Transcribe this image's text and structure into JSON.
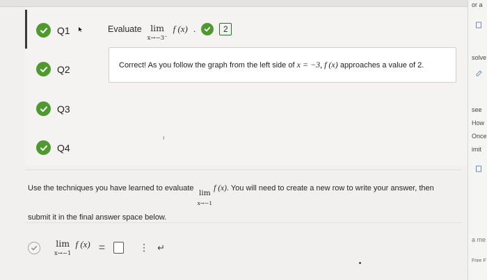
{
  "questions": [
    {
      "label": "Q1",
      "status": "correct",
      "active": true
    },
    {
      "label": "Q2",
      "status": "correct",
      "active": false
    },
    {
      "label": "Q3",
      "status": "correct",
      "active": false
    },
    {
      "label": "Q4",
      "status": "correct",
      "active": false
    }
  ],
  "q1": {
    "evaluate_label": "Evaluate",
    "lim_word": "lim",
    "lim_sub": "x→−3⁻",
    "function": "f (x)",
    "separator": ".",
    "answer_value": "2",
    "feedback_prefix": "Correct! As you follow the graph from the left side of ",
    "feedback_math1": "x = −3, f (x)",
    "feedback_suffix": " approaches a value of 2."
  },
  "task": {
    "instruction_pre": "Use the techniques you have learned to evaluate",
    "lim_word": "lim",
    "lim_sub": "x→−1",
    "function": "f (x)",
    "instruction_post": ". You will need to create a new row to write your answer, then",
    "instruction_line2": "submit it in the final answer space below."
  },
  "answer_row": {
    "lim_word": "lim",
    "lim_sub": "x→−1",
    "function": "f (x)",
    "equals": "=",
    "menu_glyph": "⋮",
    "enter_glyph": "↵"
  },
  "right_panel": {
    "texts": [
      "or a",
      "solve",
      "see",
      "How",
      "Once",
      "imit",
      "a me",
      "Free F"
    ]
  },
  "colors": {
    "check_green": "#4f9a2e",
    "answer_border": "#2d6d22"
  },
  "icons": {
    "check": "check-icon",
    "cursor": "pointer-cursor-icon",
    "enter": "enter-arrow-icon",
    "menu": "vertical-dots-icon"
  }
}
